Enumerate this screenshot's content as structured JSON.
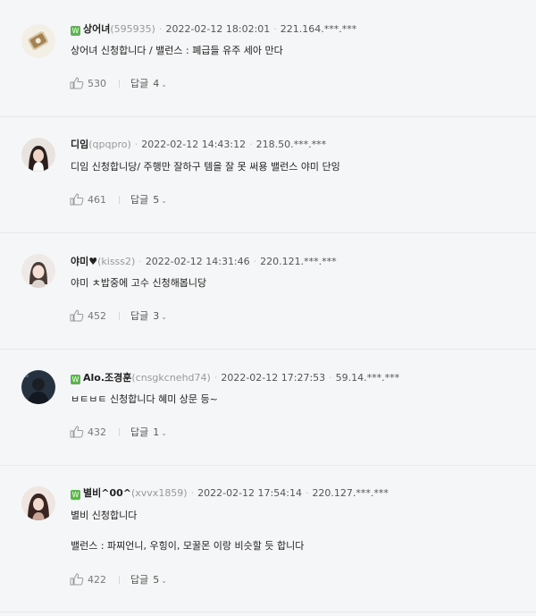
{
  "reply_label": "답글",
  "comments": [
    {
      "nickname": "상어녀",
      "user_id": "(595935)",
      "date": "2022-02-12 18:02:01",
      "ip": "221.164.***.***",
      "grade_badge": "W",
      "text": [
        "상어녀 신청합니다 / 밸런스 : 폐급들 유주 세아 만다"
      ],
      "likes": "530",
      "replies": "4"
    },
    {
      "nickname": "디임",
      "user_id": "(qpqpro)",
      "date": "2022-02-12 14:43:12",
      "ip": "218.50.***.***",
      "text": [
        "디임 신청합니당/ 주행만 잘하구 템을 잘 못 써용 밸런스 야미 단잉"
      ],
      "likes": "461",
      "replies": "5"
    },
    {
      "nickname": "야미♥",
      "user_id": "(kisss2)",
      "date": "2022-02-12 14:31:46",
      "ip": "220.121.***.***",
      "text": [
        "야미 ㅊ밥중에 고수 신청해봅니당"
      ],
      "likes": "452",
      "replies": "3"
    },
    {
      "nickname": "Alo.조경훈",
      "user_id": "(cnsgkcnehd74)",
      "date": "2022-02-12 17:27:53",
      "ip": "59.14.***.***",
      "grade_badge": "W",
      "text": [
        "ㅂㅌㅂㅌ 신청합니다 혜미 상문 등~"
      ],
      "likes": "432",
      "replies": "1"
    },
    {
      "nickname": "별비^00^",
      "user_id": "(xvvx1859)",
      "date": "2022-02-12 17:54:14",
      "ip": "220.127.***.***",
      "grade_badge": "W",
      "text": [
        "별비 신청합니다",
        "밸런스 : 파찌언니, 우힝이, 모꿀몬 이랑 비슷할 듯 합니다"
      ],
      "likes": "422",
      "replies": "5"
    }
  ]
}
